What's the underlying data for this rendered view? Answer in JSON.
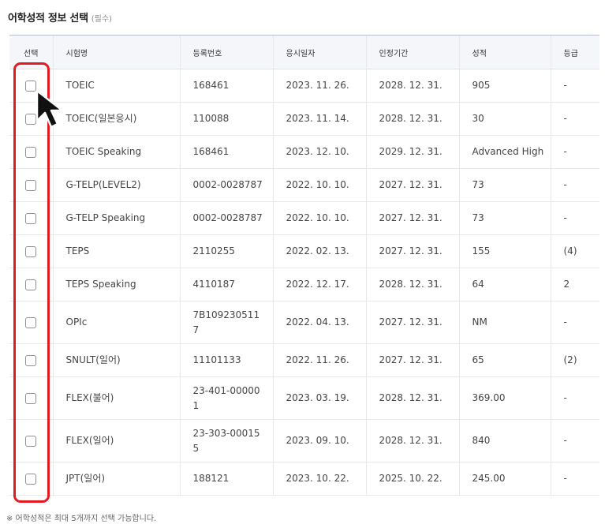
{
  "header": {
    "title": "어학성적 정보 선택",
    "required": "(필수)"
  },
  "table": {
    "columns": [
      "선택",
      "시험명",
      "등록번호",
      "응시일자",
      "인정기간",
      "성적",
      "등급"
    ],
    "rows": [
      {
        "exam": "TOEIC",
        "reg_no": "168461",
        "test_date": "2023. 11. 26.",
        "valid_until": "2028. 12. 31.",
        "score": "905",
        "grade": "-"
      },
      {
        "exam": "TOEIC(일본응시)",
        "reg_no": "110088",
        "test_date": "2023. 11. 14.",
        "valid_until": "2028. 12. 31.",
        "score": "30",
        "grade": "-"
      },
      {
        "exam": "TOEIC Speaking",
        "reg_no": "168461",
        "test_date": "2023. 12. 10.",
        "valid_until": "2029. 12. 31.",
        "score": "Advanced High",
        "grade": "-"
      },
      {
        "exam": "G-TELP(LEVEL2)",
        "reg_no": "0002-0028787",
        "test_date": "2022. 10. 10.",
        "valid_until": "2027. 12. 31.",
        "score": "73",
        "grade": "-"
      },
      {
        "exam": "G-TELP Speaking",
        "reg_no": "0002-0028787",
        "test_date": "2022. 10. 10.",
        "valid_until": "2027. 12. 31.",
        "score": "73",
        "grade": "-"
      },
      {
        "exam": "TEPS",
        "reg_no": "2110255",
        "test_date": "2022. 02. 13.",
        "valid_until": "2027. 12. 31.",
        "score": "155",
        "grade": "(4)"
      },
      {
        "exam": "TEPS Speaking",
        "reg_no": "4110187",
        "test_date": "2022. 12. 17.",
        "valid_until": "2028. 12. 31.",
        "score": "64",
        "grade": "2"
      },
      {
        "exam": "OPIc",
        "reg_no": "7B109230511\n7",
        "test_date": "2022. 04. 13.",
        "valid_until": "2027. 12. 31.",
        "score": "NM",
        "grade": "-"
      },
      {
        "exam": "SNULT(일어)",
        "reg_no": "11101133",
        "test_date": "2022. 11. 26.",
        "valid_until": "2027. 12. 31.",
        "score": "65",
        "grade": "(2)"
      },
      {
        "exam": "FLEX(불어)",
        "reg_no": "23-401-00000\n1",
        "test_date": "2023. 03. 19.",
        "valid_until": "2028. 12. 31.",
        "score": "369.00",
        "grade": "-"
      },
      {
        "exam": "FLEX(일어)",
        "reg_no": "23-303-00015\n5",
        "test_date": "2023. 09. 10.",
        "valid_until": "2028. 12. 31.",
        "score": "840",
        "grade": "-"
      },
      {
        "exam": "JPT(일어)",
        "reg_no": "188121",
        "test_date": "2023. 10. 22.",
        "valid_until": "2025. 10. 22.",
        "score": "245.00",
        "grade": "-"
      }
    ]
  },
  "footer": {
    "note": "※ 어학성적은 최대 5개까지 선택 가능합니다."
  },
  "colors": {
    "highlight": "#e21b23",
    "header_bg": "#f4f6f9",
    "cursor": "#111111"
  },
  "icons": {
    "cursor": "mouse-pointer-icon",
    "checkbox": "checkbox-unchecked"
  }
}
